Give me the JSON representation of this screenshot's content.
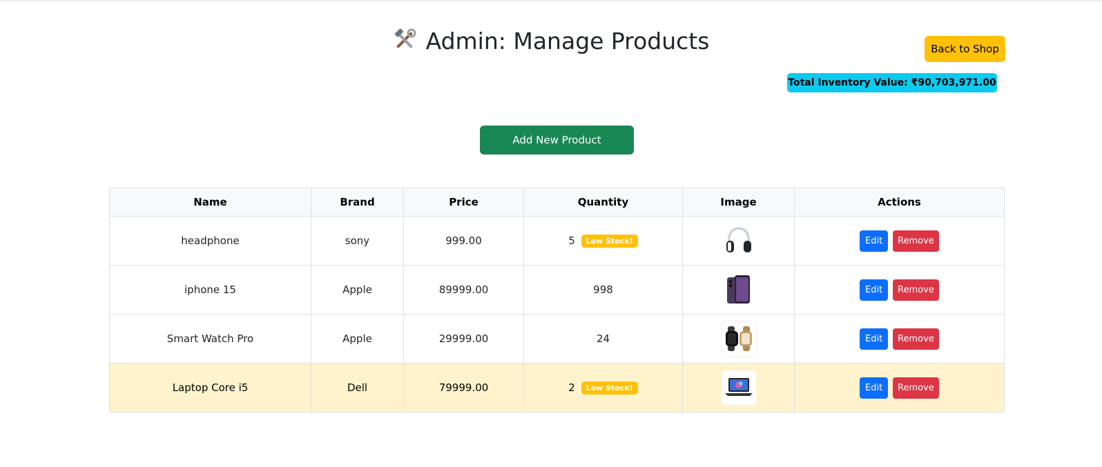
{
  "header": {
    "title": "Admin: Manage Products",
    "title_icon": "hammer-and-wrench-icon",
    "back_label": "Back to Shop",
    "inventory_value": "Total Inventory Value: ₹90,703,971.00"
  },
  "actions": {
    "add_label": "Add New Product"
  },
  "table": {
    "columns": [
      "Name",
      "Brand",
      "Price",
      "Quantity",
      "Image",
      "Actions"
    ],
    "low_stock_label": "Low Stock!",
    "edit_label": "Edit",
    "remove_label": "Remove",
    "rows": [
      {
        "name": "headphone",
        "brand": "sony",
        "price": "999.00",
        "quantity": "5",
        "low_stock": true,
        "image": "headphones-icon"
      },
      {
        "name": "iphone 15",
        "brand": "Apple",
        "price": "89999.00",
        "quantity": "998",
        "low_stock": false,
        "image": "smartphone-icon"
      },
      {
        "name": "Smart Watch Pro",
        "brand": "Apple",
        "price": "29999.00",
        "quantity": "24",
        "low_stock": false,
        "image": "smartwatch-icon"
      },
      {
        "name": "Laptop Core i5",
        "brand": "Dell",
        "price": "79999.00",
        "quantity": "2",
        "low_stock": true,
        "image": "laptop-icon"
      }
    ]
  },
  "colors": {
    "warning": "#ffc107",
    "info": "#0dcaf0",
    "success": "#198754",
    "primary": "#0d6efd",
    "danger": "#dc3545",
    "row_highlight": "#fff3cd"
  }
}
